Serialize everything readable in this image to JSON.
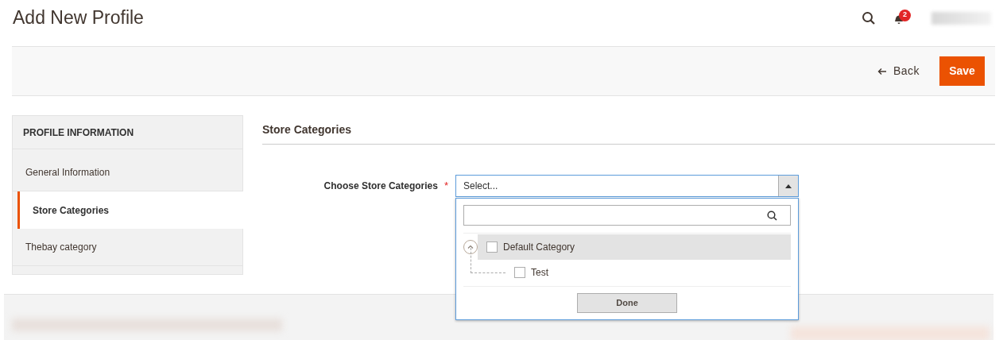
{
  "page_title": "Add New Profile",
  "header": {
    "notifications_count": "2"
  },
  "actions": {
    "back": "Back",
    "save": "Save"
  },
  "sidebar": {
    "title": "PROFILE INFORMATION",
    "items": [
      {
        "label": "General Information",
        "selected": false
      },
      {
        "label": "Store Categories",
        "selected": true
      },
      {
        "label": "Thebay category",
        "selected": false
      }
    ]
  },
  "section": {
    "title": "Store Categories",
    "field": {
      "label": "Choose Store Categories",
      "required_mark": "*",
      "placeholder": "Select...",
      "expanded": true,
      "tree": [
        {
          "label": "Default Category",
          "checked": false,
          "highlighted": true,
          "expanded": true,
          "children": [
            {
              "label": "Test",
              "checked": false,
              "highlighted": false
            }
          ]
        }
      ],
      "done": "Done"
    }
  }
}
